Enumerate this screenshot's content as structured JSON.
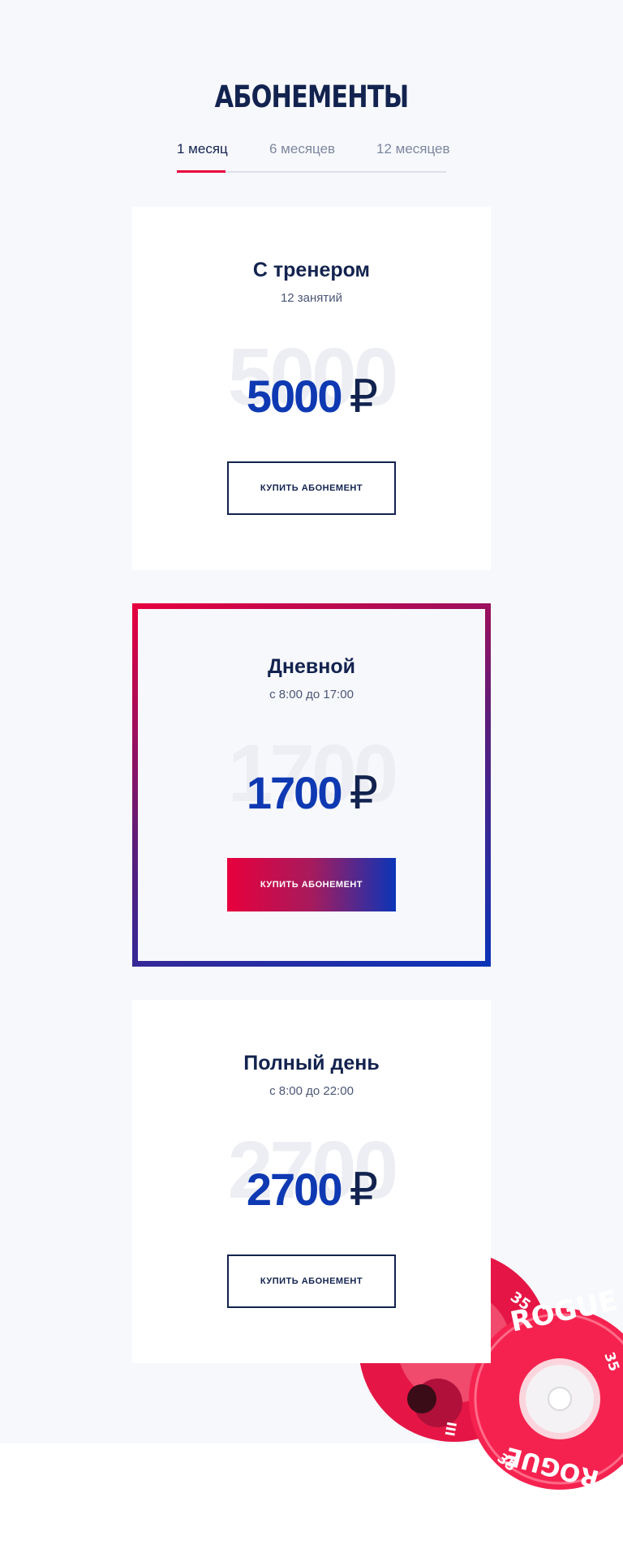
{
  "section": {
    "title": "АБОНЕМЕНТЫ"
  },
  "tabs": [
    {
      "label": "1 месяц",
      "active": true
    },
    {
      "label": "6 месяцев",
      "active": false
    },
    {
      "label": "12 месяцев",
      "active": false
    }
  ],
  "plans": [
    {
      "title": "С тренером",
      "subtitle": "12 занятий",
      "ghost": "5000",
      "price": "5000",
      "currency": "₽",
      "button": "КУПИТЬ АБОНЕМЕНТ",
      "featured": false
    },
    {
      "title": "Дневной",
      "subtitle": "с 8:00 до 17:00",
      "ghost": "1700",
      "price": "1700",
      "currency": "₽",
      "button": "КУПИТЬ АБОНЕМЕНТ",
      "featured": true
    },
    {
      "title": "Полный день",
      "subtitle": "с 8:00 до 22:00",
      "ghost": "2700",
      "price": "2700",
      "currency": "₽",
      "button": "КУПИТЬ АБОНЕМЕНТ",
      "featured": false
    }
  ],
  "plates": {
    "brand_text": "ROGUE",
    "weight_text": "35"
  },
  "colors": {
    "accent_red": "#e8003d",
    "accent_blue": "#0e39b2",
    "navy": "#13234f",
    "plate_red": "#f5224f"
  }
}
